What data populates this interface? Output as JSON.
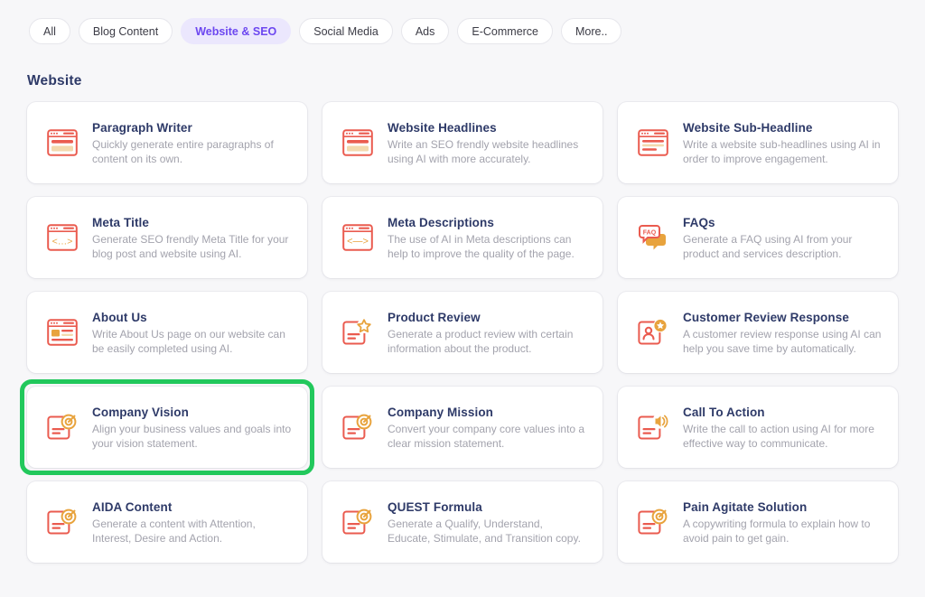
{
  "filters": [
    {
      "label": "All",
      "active": false
    },
    {
      "label": "Blog Content",
      "active": false
    },
    {
      "label": "Website & SEO",
      "active": true
    },
    {
      "label": "Social Media",
      "active": false
    },
    {
      "label": "Ads",
      "active": false
    },
    {
      "label": "E-Commerce",
      "active": false
    },
    {
      "label": "More..",
      "active": false
    }
  ],
  "section": {
    "title": "Website"
  },
  "colors": {
    "accent_purple": "#6c47f0",
    "pill_active_bg": "#ebe7fd",
    "heading_navy": "#2e3a68",
    "icon_red": "#ea5b4f",
    "icon_orange": "#e8a33d",
    "highlight_green": "#22c85c",
    "page_bg": "#f7f7f9"
  },
  "cards": [
    {
      "title": "Paragraph Writer",
      "desc": "Quickly generate entire paragraphs of content on its own.",
      "icon": "browser-text-icon",
      "highlighted": false
    },
    {
      "title": "Website Headlines",
      "desc": "Write an SEO frendly website headlines using AI with more accurately.",
      "icon": "browser-text-icon",
      "highlighted": false
    },
    {
      "title": "Website Sub-Headline",
      "desc": "Write a website sub-headlines using AI in order to improve engagement.",
      "icon": "browser-lines-icon",
      "highlighted": false
    },
    {
      "title": "Meta Title",
      "desc": "Generate SEO frendly Meta Title for your blog post and website using AI.",
      "icon": "browser-code-icon",
      "highlighted": false
    },
    {
      "title": "Meta Descriptions",
      "desc": "The use of AI in Meta descriptions can help to improve the quality of the page.",
      "icon": "browser-arrows-icon",
      "highlighted": false
    },
    {
      "title": "FAQs",
      "desc": "Generate a FAQ using AI from your product and services description.",
      "icon": "faq-bubble-icon",
      "highlighted": false
    },
    {
      "title": "About Us",
      "desc": "Write About Us page on our website can be easily completed using AI.",
      "icon": "browser-block-icon",
      "highlighted": false
    },
    {
      "title": "Product Review",
      "desc": "Generate a product review with certain information about the product.",
      "icon": "document-star-icon",
      "highlighted": false
    },
    {
      "title": "Customer Review Response",
      "desc": "A customer review response using AI can help you save time by automatically.",
      "icon": "document-user-star-icon",
      "highlighted": false
    },
    {
      "title": "Company Vision",
      "desc": "Align your business values and goals into your vision statement.",
      "icon": "document-target-icon",
      "highlighted": true
    },
    {
      "title": "Company Mission",
      "desc": "Convert your company core values into a clear mission statement.",
      "icon": "document-target-icon",
      "highlighted": false
    },
    {
      "title": "Call To Action",
      "desc": "Write the call to action using AI for more effective way to communicate.",
      "icon": "document-speaker-icon",
      "highlighted": false
    },
    {
      "title": "AIDA Content",
      "desc": "Generate a content with Attention, Interest, Desire and Action.",
      "icon": "document-target-icon",
      "highlighted": false
    },
    {
      "title": "QUEST Formula",
      "desc": "Generate a Qualify, Understand, Educate, Stimulate, and Transition copy.",
      "icon": "document-target-icon",
      "highlighted": false
    },
    {
      "title": "Pain Agitate Solution",
      "desc": "A copywriting formula to explain how to avoid pain to get gain.",
      "icon": "document-target-icon",
      "highlighted": false
    }
  ]
}
